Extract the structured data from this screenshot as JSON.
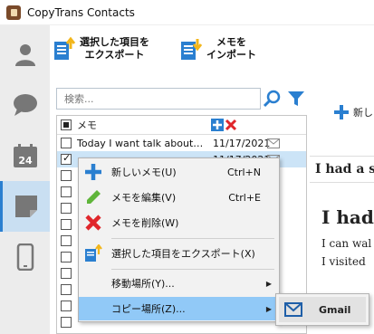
{
  "app": {
    "title": "CopyTrans Contacts"
  },
  "sidebar": {
    "items": [
      {
        "name": "contacts",
        "icon": "person-icon"
      },
      {
        "name": "messages",
        "icon": "chat-bubble-icon"
      },
      {
        "name": "calendar",
        "icon": "calendar-icon",
        "day": "24"
      },
      {
        "name": "notes",
        "icon": "note-icon",
        "active": true
      },
      {
        "name": "device",
        "icon": "phone-icon"
      }
    ]
  },
  "toolbar": {
    "export_label_1": "選択した項目を",
    "export_label_2": "エクスポート",
    "import_label_1": "メモを",
    "import_label_2": "インポート"
  },
  "search": {
    "placeholder": "検索..."
  },
  "list": {
    "header": "メモ",
    "rows": [
      {
        "subject": "Today I want talk about l...",
        "date": "11/17/2021",
        "checked": false,
        "selected": false
      },
      {
        "subject": "",
        "date": "11/17/2021",
        "checked": true,
        "selected": true
      },
      {
        "subject": "",
        "date": "",
        "checked": false,
        "selected": false
      },
      {
        "subject": "",
        "date": "",
        "checked": false,
        "selected": false
      },
      {
        "subject": "",
        "date": "",
        "checked": false,
        "selected": false
      },
      {
        "subject": "",
        "date": "",
        "checked": false,
        "selected": false
      },
      {
        "subject": "",
        "date": "",
        "checked": false,
        "selected": false
      },
      {
        "subject": "",
        "date": "",
        "checked": false,
        "selected": false
      },
      {
        "subject": "",
        "date": "",
        "checked": false,
        "selected": false
      },
      {
        "subject": "",
        "date": "",
        "checked": false,
        "selected": false
      },
      {
        "subject": "",
        "date": "",
        "checked": false,
        "selected": false
      },
      {
        "subject": "",
        "date": "",
        "checked": false,
        "selected": false
      }
    ]
  },
  "detail": {
    "new_button": "新し",
    "title": "I had a su",
    "heading": "I had",
    "line1": "I can wal",
    "line2": "I visited"
  },
  "context_menu": {
    "items": [
      {
        "label": "新しいメモ(U)",
        "shortcut": "Ctrl+N",
        "icon": "plus-icon"
      },
      {
        "label": "メモを編集(V)",
        "shortcut": "Ctrl+E",
        "icon": "pencil-icon"
      },
      {
        "label": "メモを削除(W)",
        "shortcut": "",
        "icon": "delete-x-icon"
      },
      {
        "label": "選択した項目をエクスポート(X)",
        "shortcut": "",
        "icon": "export-icon"
      },
      {
        "label": "移動場所(Y)...",
        "shortcut": "",
        "icon": ""
      },
      {
        "label": "コピー場所(Z)...",
        "shortcut": "",
        "icon": ""
      }
    ]
  },
  "submenu": {
    "gmail_label": "Gmail"
  },
  "colors": {
    "accent": "#2a7fd0",
    "hover": "#91c9f7",
    "selected_row": "#cce4f7",
    "delete": "#e0262b",
    "pencil": "#5fb53a"
  }
}
